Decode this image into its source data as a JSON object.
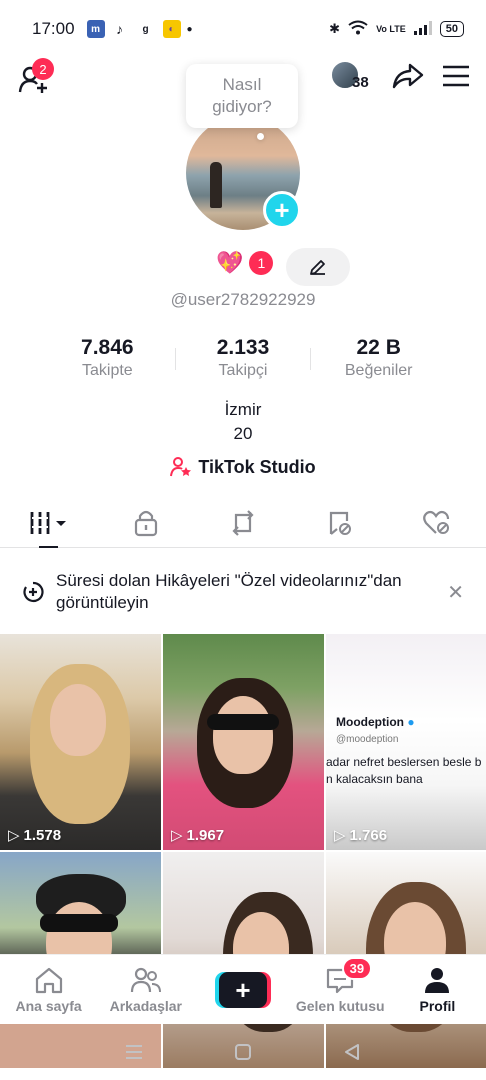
{
  "status_bar": {
    "time": "17:00",
    "battery": "50",
    "network": "Vo LTE"
  },
  "top": {
    "friend_requests_badge": "2",
    "viewer_count": "38"
  },
  "bubble": {
    "text_line1": "Nasıl",
    "text_line2": "gidiyor?"
  },
  "profile": {
    "badge_count": "1",
    "username": "@user2782922929",
    "stats": [
      {
        "value": "7.846",
        "label": "Takipte"
      },
      {
        "value": "2.133",
        "label": "Takipçi"
      },
      {
        "value": "22 B",
        "label": "Beğeniler"
      }
    ],
    "bio_line1": "İzmir",
    "bio_line2": "20",
    "studio_label": "TikTok Studio"
  },
  "tabs": [
    {
      "icon": "videos-grid-icon"
    },
    {
      "icon": "lock-icon"
    },
    {
      "icon": "repost-icon"
    },
    {
      "icon": "favorites-icon"
    },
    {
      "icon": "liked-icon"
    }
  ],
  "notice": {
    "text": "Süresi dolan Hikâyeleri \"Özel videolarınız\"dan görüntüleyin"
  },
  "videos": [
    {
      "views": "1.578"
    },
    {
      "views": "1.967"
    },
    {
      "views": "1.766",
      "tweet_handle": "Moodeption",
      "tweet_sub": "@moodeption",
      "tweet_line1": "adar nefret beslersen besle b",
      "tweet_line2": "n kalacaksın bana"
    },
    {
      "views": ""
    },
    {
      "views": ""
    },
    {
      "views": ""
    }
  ],
  "bottom_nav": {
    "home": "Ana sayfa",
    "friends": "Arkadaşlar",
    "inbox": "Gelen kutusu",
    "inbox_badge": "39",
    "profile": "Profil"
  },
  "colors": {
    "accent": "#fe2c55",
    "cyan": "#20d5ec",
    "text": "#161823",
    "muted": "#8a8b91"
  }
}
